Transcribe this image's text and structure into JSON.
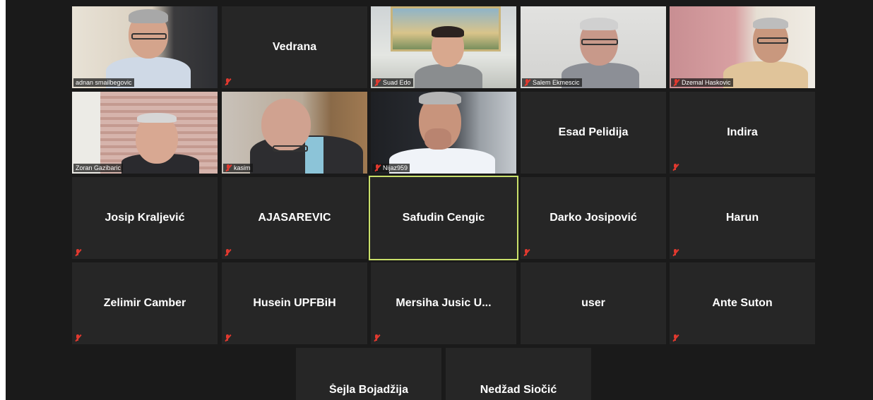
{
  "participants": [
    {
      "name": "adnan smailbegovic",
      "video": true,
      "muted": false
    },
    {
      "name": "Vedrana",
      "video": false,
      "muted": true
    },
    {
      "name": "Suad Edo",
      "video": true,
      "muted": true
    },
    {
      "name": "Salem Ekmescic",
      "video": true,
      "muted": true
    },
    {
      "name": "Dzemal Haskovic",
      "video": true,
      "muted": true
    },
    {
      "name": "Zoran Gazibaric",
      "video": true,
      "muted": false
    },
    {
      "name": "kasim",
      "video": true,
      "muted": true
    },
    {
      "name": "Nijaz959",
      "video": true,
      "muted": true
    },
    {
      "name": "Esad Pelidija",
      "video": false,
      "muted": false
    },
    {
      "name": "Indira",
      "video": false,
      "muted": true
    },
    {
      "name": "Josip Kraljević",
      "video": false,
      "muted": true
    },
    {
      "name": "AJASAREVIC",
      "video": false,
      "muted": true
    },
    {
      "name": "Safudin Cengic",
      "video": false,
      "muted": false,
      "active_speaker": true
    },
    {
      "name": "Darko Josipović",
      "video": false,
      "muted": true
    },
    {
      "name": "Harun",
      "video": false,
      "muted": true
    },
    {
      "name": "Zelimir Camber",
      "video": false,
      "muted": true
    },
    {
      "name": "Husein UPFBiH",
      "video": false,
      "muted": true
    },
    {
      "name": "Mersiha Jusic U...",
      "video": false,
      "muted": true
    },
    {
      "name": "user",
      "video": false,
      "muted": false
    },
    {
      "name": "Ante Suton",
      "video": false,
      "muted": true
    },
    {
      "name": "Šejla Bojadžija",
      "video": false,
      "muted": false
    },
    {
      "name": "Nedžad Siočić",
      "video": false,
      "muted": false
    }
  ],
  "colors": {
    "active_border": "#c9e06a",
    "tile_bg": "#262626",
    "stage_bg": "#1a1a1a",
    "mute_red": "#e0392f"
  }
}
